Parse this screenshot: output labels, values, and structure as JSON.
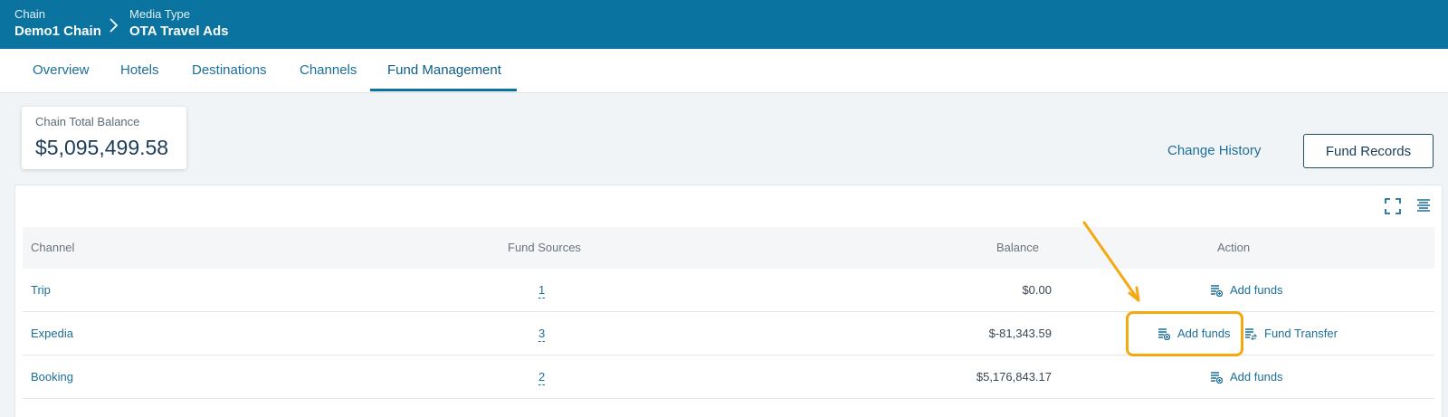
{
  "header": {
    "chain_label": "Chain",
    "chain_value": "Demo1 Chain",
    "media_label": "Media Type",
    "media_value": "OTA Travel Ads"
  },
  "tabs": [
    {
      "label": "Overview",
      "active": false
    },
    {
      "label": "Hotels",
      "active": false
    },
    {
      "label": "Destinations",
      "active": false
    },
    {
      "label": "Channels",
      "active": false
    },
    {
      "label": "Fund Management",
      "active": true
    }
  ],
  "balance_card": {
    "label": "Chain Total Balance",
    "amount": "$5,095,499.58"
  },
  "buttons": {
    "change_history": "Change History",
    "fund_records": "Fund Records"
  },
  "table": {
    "headers": {
      "channel": "Channel",
      "fund_sources": "Fund Sources",
      "balance": "Balance",
      "action": "Action"
    },
    "rows": [
      {
        "channel": "Trip",
        "fund_sources": "1",
        "balance": "$0.00",
        "actions": [
          "Add funds"
        ]
      },
      {
        "channel": "Expedia",
        "fund_sources": "3",
        "balance": "$-81,343.59",
        "actions": [
          "Add funds",
          "Fund Transfer"
        ]
      },
      {
        "channel": "Booking",
        "fund_sources": "2",
        "balance": "$5,176,843.17",
        "actions": [
          "Add funds"
        ]
      }
    ]
  },
  "icons": {
    "breadcrumb_separator": "chevron-right-icon",
    "fullscreen": "expand-icon",
    "density": "table-density-icon",
    "add_funds": "add-funds-icon",
    "fund_transfer": "fund-transfer-icon"
  },
  "colors": {
    "header_bg": "#0a739f",
    "accent": "#1c6f98",
    "highlight": "#f4a913"
  }
}
